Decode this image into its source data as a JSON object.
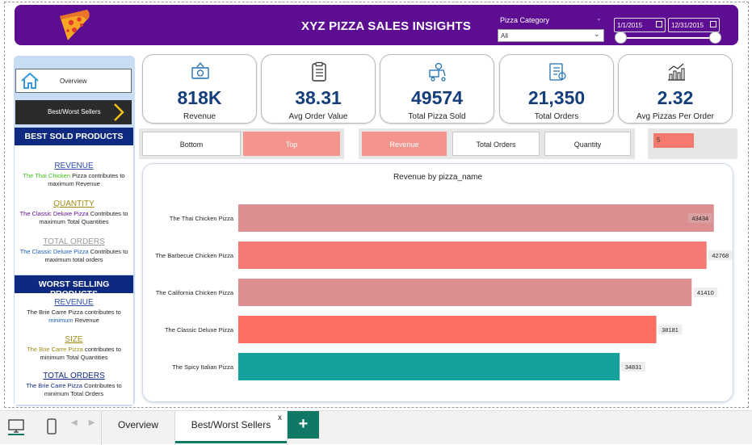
{
  "header": {
    "title": "XYZ PIZZA SALES INSIGHTS",
    "category_label": "Pizza Category",
    "category_value": "All",
    "date_start": "1/1/2015",
    "date_end": "12/31/2015"
  },
  "nav": {
    "overview_label": "Overview",
    "best_worst_label": "Best/Worst Sellers"
  },
  "best": {
    "heading": "BEST SOLD PRODUCTS",
    "revenue_h": "REVENUE",
    "revenue_pizza": "The Thai Chicken",
    "revenue_rest": " Pizza contributes to maximum Revenue",
    "quantity_h": "QUANTITY",
    "quantity_pizza": "The Classic Deluxe Pizza",
    "quantity_rest": " Contributes to maximum Total Quantities",
    "orders_h": "TOTAL ORDERS",
    "orders_pizza": "The Classic Deluxe Pizza",
    "orders_rest": " Contributes to maximum total orders"
  },
  "worst": {
    "heading": "WORST SELLING PRODUCTS",
    "revenue_h": "REVENUE",
    "revenue_pre": "The Brie Carre Pizza contributes to ",
    "revenue_hl": "minimum",
    "revenue_post": " Revenue",
    "size_h": "SIZE",
    "size_pizza": "The Brie Carre Pizza",
    "size_rest": " contributes to minimum Total Quantities",
    "orders_h": "TOTAL ORDERS",
    "orders_pizza": "The Brie Carre Pizza",
    "orders_rest": " Contributes to minimum Total Orders"
  },
  "kpis": [
    {
      "value": "818K",
      "label": "Revenue",
      "icon": "money-icon"
    },
    {
      "value": "38.31",
      "label": "Avg Order Value",
      "icon": "clipboard-icon"
    },
    {
      "value": "49574",
      "label": "Total Pizza Sold",
      "icon": "delivery-person-icon"
    },
    {
      "value": "21,350",
      "label": "Total Orders",
      "icon": "order-list-icon"
    },
    {
      "value": "2.32",
      "label": "Avg Pizzas Per Order",
      "icon": "growth-chart-icon"
    }
  ],
  "toggles": {
    "bottom": "Bottom",
    "top": "Top",
    "revenue": "Revenue",
    "total_orders": "Total Orders",
    "quantity": "Quantity",
    "topn": "5"
  },
  "chart_data": {
    "type": "bar",
    "title": "Revenue by pizza_name",
    "orientation": "horizontal",
    "categories": [
      "The Thai Chicken Pizza",
      "The Barbecue Chicken Pizza",
      "The California Chicken Pizza",
      "The Classic Deluxe Pizza",
      "The Spicy Italian Pizza"
    ],
    "values": [
      43434,
      42768,
      41410,
      38181,
      34831
    ],
    "xlim": [
      0,
      45000
    ],
    "colors": [
      "#dc8f91",
      "#f47a73",
      "#dc8f91",
      "#fc6e63",
      "#14a19b"
    ]
  },
  "tabs": {
    "overview": "Overview",
    "best": "Best/Worst Sellers",
    "close": "x",
    "add": "+"
  }
}
